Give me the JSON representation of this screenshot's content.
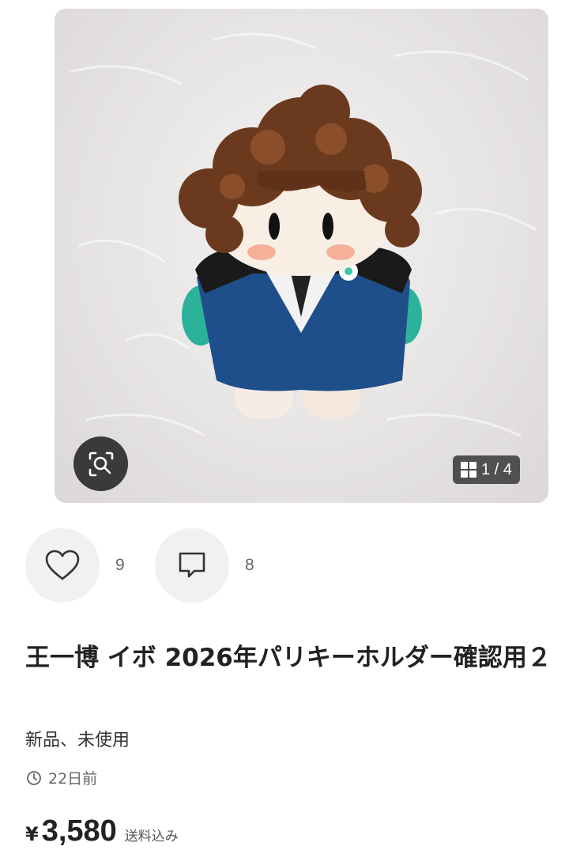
{
  "product": {
    "image_counter": "1 / 4",
    "likes": "9",
    "comments": "8",
    "title": "王一博 イボ 2026年パリキーホルダー確認用２",
    "condition": "新品、未使用",
    "posted": "22日前",
    "currency": "¥",
    "price": "3,580",
    "shipping_note": "送料込み"
  },
  "icons": {
    "zoom": "search-zoom-icon",
    "gallery": "grid-icon",
    "like": "heart-icon",
    "comment": "comment-icon",
    "time": "clock-icon"
  }
}
